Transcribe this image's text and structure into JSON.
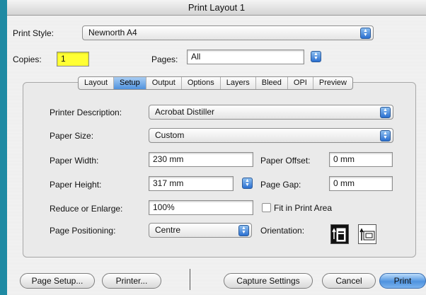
{
  "window": {
    "title": "Print Layout 1"
  },
  "print_style": {
    "label": "Print Style:",
    "value": "Newnorth A4"
  },
  "copies": {
    "label": "Copies:",
    "value": "1"
  },
  "pages": {
    "label": "Pages:",
    "value": "All"
  },
  "tabs": [
    {
      "label": "Layout",
      "active": false
    },
    {
      "label": "Setup",
      "active": true
    },
    {
      "label": "Output",
      "active": false
    },
    {
      "label": "Options",
      "active": false
    },
    {
      "label": "Layers",
      "active": false
    },
    {
      "label": "Bleed",
      "active": false
    },
    {
      "label": "OPI",
      "active": false
    },
    {
      "label": "Preview",
      "active": false
    }
  ],
  "setup": {
    "printer_description": {
      "label": "Printer Description:",
      "value": "Acrobat Distiller"
    },
    "paper_size": {
      "label": "Paper Size:",
      "value": "Custom"
    },
    "paper_width": {
      "label": "Paper Width:",
      "value": "230 mm"
    },
    "paper_offset": {
      "label": "Paper Offset:",
      "value": "0 mm"
    },
    "paper_height": {
      "label": "Paper Height:",
      "value": "317 mm"
    },
    "page_gap": {
      "label": "Page Gap:",
      "value": "0 mm"
    },
    "reduce_enlarge": {
      "label": "Reduce or Enlarge:",
      "value": "100%"
    },
    "fit_in_print_area": {
      "label": "Fit in Print Area",
      "checked": false
    },
    "page_positioning": {
      "label": "Page Positioning:",
      "value": "Centre"
    },
    "orientation": {
      "label": "Orientation:",
      "selected": "portrait"
    }
  },
  "buttons": {
    "page_setup": "Page Setup...",
    "printer": "Printer...",
    "capture_settings": "Capture Settings",
    "cancel": "Cancel",
    "print": "Print"
  },
  "colors": {
    "accent": "#4f92de",
    "highlight_field": "#ffff33",
    "desktop": "#1f8aa3"
  },
  "icons": {
    "popup": "up-down-arrows-icon",
    "portrait": "portrait-orientation-icon",
    "landscape": "landscape-orientation-icon"
  }
}
